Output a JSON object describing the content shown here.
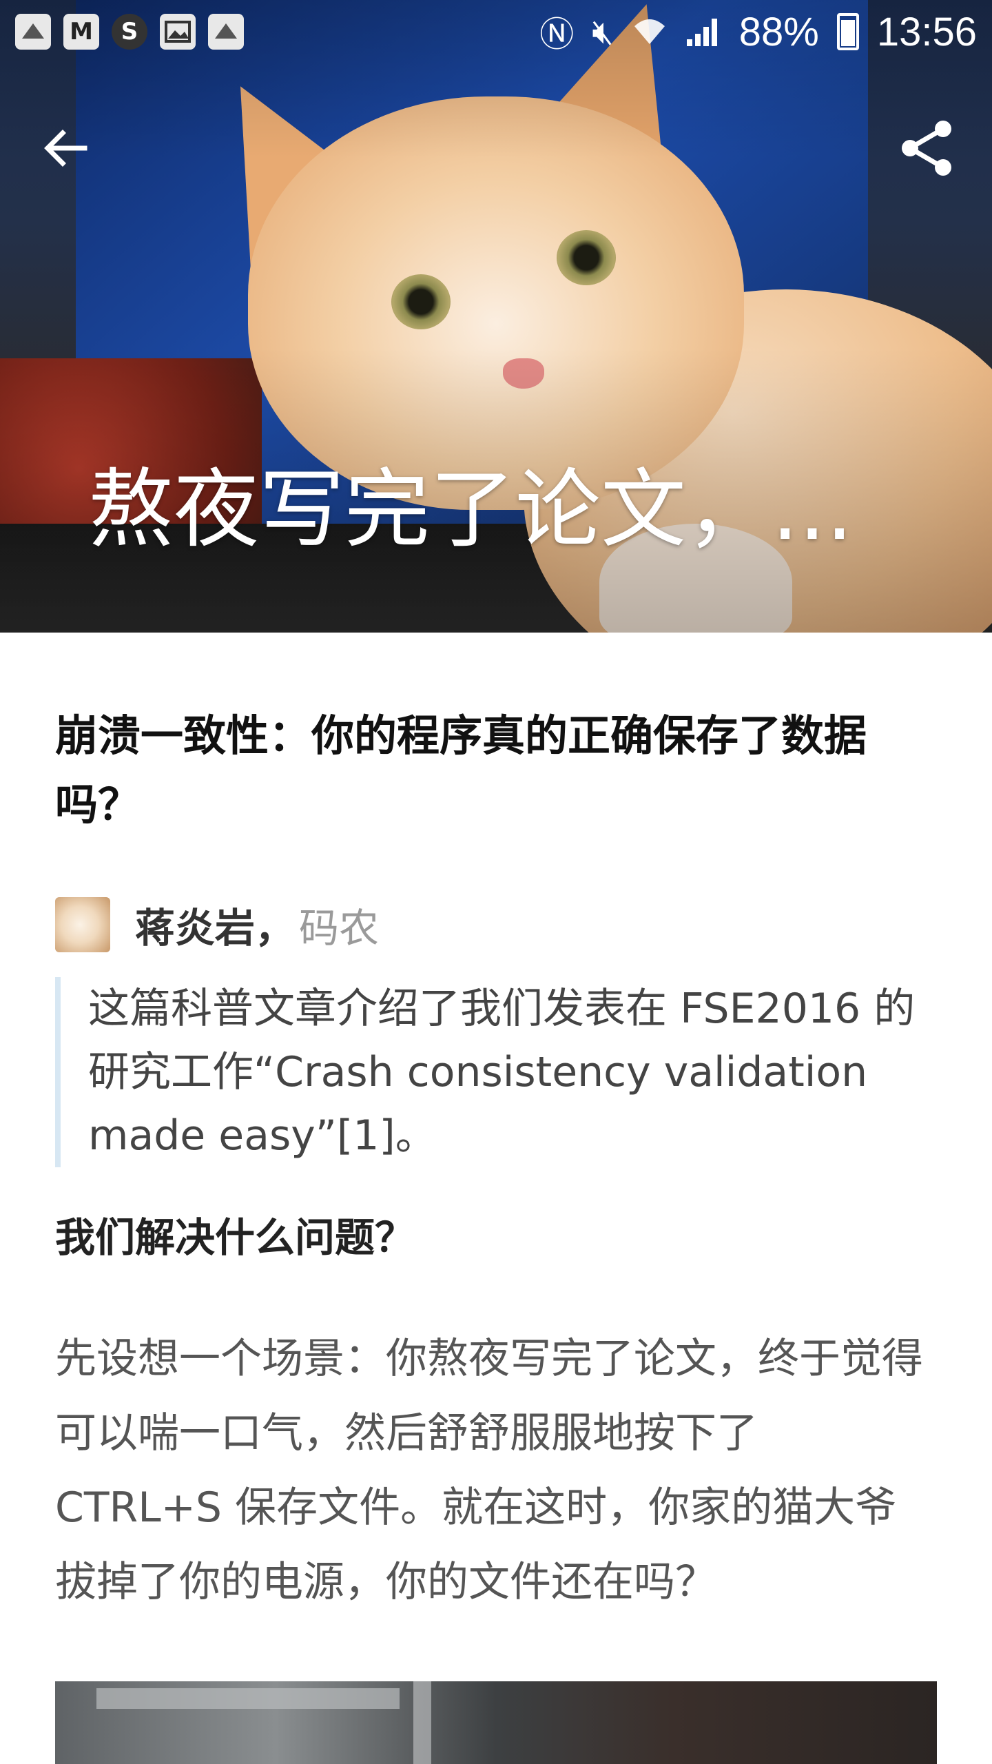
{
  "status_bar": {
    "app_icons": [
      "M",
      "S"
    ],
    "battery": "88%",
    "time": "13:56"
  },
  "hero": {
    "title": "熬夜写完了论文，..."
  },
  "article": {
    "headline": "崩溃一致性：你的程序真的正确保存了数据吗？",
    "author": {
      "name": "蒋炎岩",
      "separator": "，",
      "role": "码农"
    },
    "quote": "这篇科普文章介绍了我们发表在 FSE2016 的研究工作“Crash consistency validation made easy”[1]。",
    "section_title": "我们解决什么问题？",
    "body": "先设想一个场景：你熬夜写完了论文，终于觉得可以喘一口气，然后舒舒服服地按下了 CTRL+S 保存文件。就在这时，你家的猫大爷拔掉了你的电源，你的文件还在吗？"
  },
  "icons": {
    "back": "arrow-left",
    "share": "share"
  }
}
